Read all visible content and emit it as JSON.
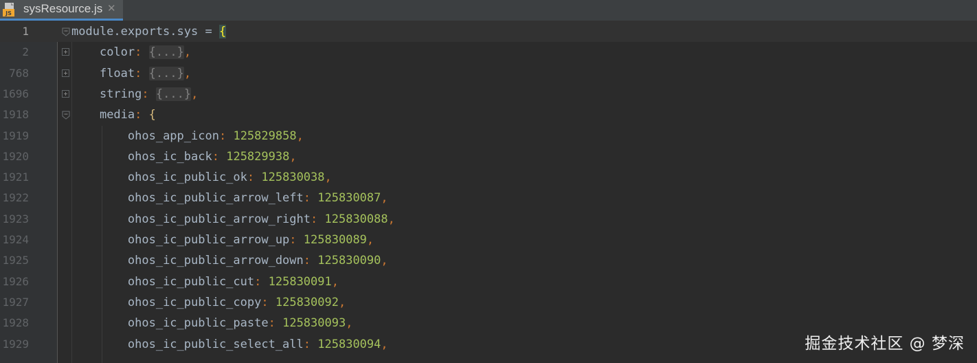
{
  "tab": {
    "filename": "sysResource.js",
    "icon": "js-file-icon",
    "icon_badge": "JS",
    "close_glyph": "✕"
  },
  "editor": {
    "lines": [
      {
        "no": "1",
        "key": "",
        "prefix": "module.exports.sys = ",
        "open": "{",
        "kind": "head"
      },
      {
        "no": "2",
        "key": "color",
        "kind": "folded"
      },
      {
        "no": "768",
        "key": "float",
        "kind": "folded"
      },
      {
        "no": "1696",
        "key": "string",
        "kind": "folded"
      },
      {
        "no": "1918",
        "key": "media",
        "kind": "open"
      },
      {
        "no": "1919",
        "key": "ohos_app_icon",
        "value": "125829858",
        "kind": "entry"
      },
      {
        "no": "1920",
        "key": "ohos_ic_back",
        "value": "125829938",
        "kind": "entry"
      },
      {
        "no": "1921",
        "key": "ohos_ic_public_ok",
        "value": "125830038",
        "kind": "entry"
      },
      {
        "no": "1922",
        "key": "ohos_ic_public_arrow_left",
        "value": "125830087",
        "kind": "entry"
      },
      {
        "no": "1923",
        "key": "ohos_ic_public_arrow_right",
        "value": "125830088",
        "kind": "entry"
      },
      {
        "no": "1924",
        "key": "ohos_ic_public_arrow_up",
        "value": "125830089",
        "kind": "entry"
      },
      {
        "no": "1925",
        "key": "ohos_ic_public_arrow_down",
        "value": "125830090",
        "kind": "entry"
      },
      {
        "no": "1926",
        "key": "ohos_ic_public_cut",
        "value": "125830091",
        "kind": "entry"
      },
      {
        "no": "1927",
        "key": "ohos_ic_public_copy",
        "value": "125830092",
        "kind": "entry"
      },
      {
        "no": "1928",
        "key": "ohos_ic_public_paste",
        "value": "125830093",
        "kind": "entry"
      },
      {
        "no": "1929",
        "key": "ohos_ic_public_select_all",
        "value": "125830094",
        "kind": "entry"
      }
    ],
    "folded_placeholder": "{...}"
  },
  "colors": {
    "background": "#2b2b2b",
    "gutter": "#313335",
    "keyword_text": "#a9b7c6",
    "punctuation": "#cc7832",
    "number": "#a5c25c",
    "tab_underline": "#4a88c7"
  },
  "watermark": "掘金技术社区 @ 梦深"
}
